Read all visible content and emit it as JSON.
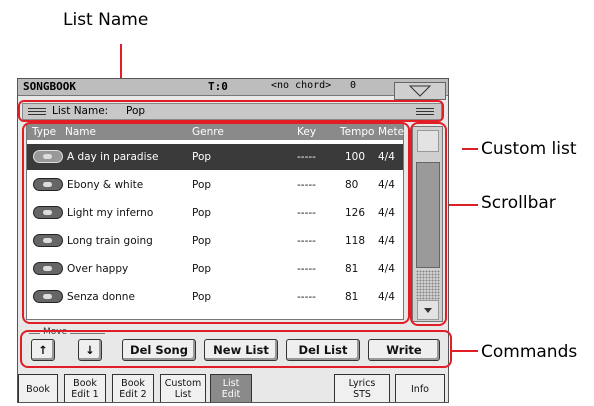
{
  "callouts": {
    "list_name": "List Name",
    "custom_list": "Custom list",
    "scrollbar": "Scrollbar",
    "commands": "Commands"
  },
  "topbar": {
    "title": "SONGBOOK",
    "tempo_label": "T:0",
    "chord": "<no chord>",
    "chord_num": "0",
    "menu_icon": "triangle-down-icon"
  },
  "listbar": {
    "label": "List Name:",
    "value": "Pop"
  },
  "table": {
    "headers": [
      "Type",
      "Name",
      "Genre",
      "Key",
      "Tempo",
      "Mete"
    ],
    "rows": [
      {
        "name": "A day in paradise",
        "genre": "Pop",
        "key": "-----",
        "tempo": "100",
        "meter": "4/4",
        "selected": true
      },
      {
        "name": "Ebony & white",
        "genre": "Pop",
        "key": "-----",
        "tempo": "80",
        "meter": "4/4"
      },
      {
        "name": "Light my inferno",
        "genre": "Pop",
        "key": "-----",
        "tempo": "126",
        "meter": "4/4"
      },
      {
        "name": "Long train going",
        "genre": "Pop",
        "key": "-----",
        "tempo": "118",
        "meter": "4/4"
      },
      {
        "name": "Over happy",
        "genre": "Pop",
        "key": "-----",
        "tempo": "81",
        "meter": "4/4"
      },
      {
        "name": "Senza donne",
        "genre": "Pop",
        "key": "-----",
        "tempo": "81",
        "meter": "4/4"
      }
    ]
  },
  "move_label": "Move",
  "buttons": {
    "up": "↑",
    "down": "↓",
    "del_song": "Del Song",
    "new_list": "New List",
    "del_list": "Del List",
    "write": "Write"
  },
  "tabs": [
    {
      "l1": "Book",
      "l2": ""
    },
    {
      "l1": "Book",
      "l2": "Edit 1"
    },
    {
      "l1": "Book",
      "l2": "Edit 2"
    },
    {
      "l1": "Custom",
      "l2": "List"
    },
    {
      "l1": "List",
      "l2": "Edit",
      "selected": true
    },
    {
      "l1": "Lyrics",
      "l2": "STS"
    },
    {
      "l1": "Info",
      "l2": ""
    }
  ],
  "colors": {
    "callout_red": "#e11e26",
    "selected_row": "#3a3a3a",
    "selected_tab": "#8a8a8a"
  }
}
